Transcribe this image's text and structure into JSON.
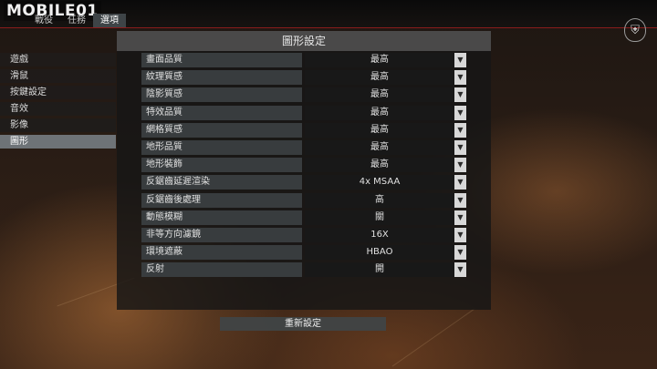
{
  "app": {
    "logo": "MOBILE01",
    "top_tabs": [
      "戰役",
      "任務",
      "選項"
    ],
    "active_top_tab": "選項",
    "emblem_icon": "shield-emblem-icon"
  },
  "panel": {
    "title": "圖形設定",
    "reset_label": "重新設定"
  },
  "sidebar": {
    "items": [
      {
        "label": "遊戲"
      },
      {
        "label": "滑鼠"
      },
      {
        "label": "按鍵設定"
      },
      {
        "label": "音效"
      },
      {
        "label": "影像"
      },
      {
        "label": "圖形"
      }
    ],
    "active": "圖形"
  },
  "settings": [
    {
      "label": "畫面品質",
      "value": "最高"
    },
    {
      "label": "紋理質感",
      "value": "最高"
    },
    {
      "label": "陰影質感",
      "value": "最高"
    },
    {
      "label": "特效品質",
      "value": "最高"
    },
    {
      "label": "網格質感",
      "value": "最高"
    },
    {
      "label": "地形品質",
      "value": "最高"
    },
    {
      "label": "地形裝飾",
      "value": "最高"
    },
    {
      "label": "反鋸齒延遲渲染",
      "value": "4x MSAA"
    },
    {
      "label": "反鋸齒後處理",
      "value": "高"
    },
    {
      "label": "動態模糊",
      "value": "關"
    },
    {
      "label": "非等方向濾鏡",
      "value": "16X"
    },
    {
      "label": "環境遮蔽",
      "value": "HBAO"
    },
    {
      "label": "反射",
      "value": "開"
    }
  ],
  "colors": {
    "accent_red": "#8a1c1c",
    "active_item": "#6e7377",
    "row_label_bg": "#3a3e40"
  }
}
